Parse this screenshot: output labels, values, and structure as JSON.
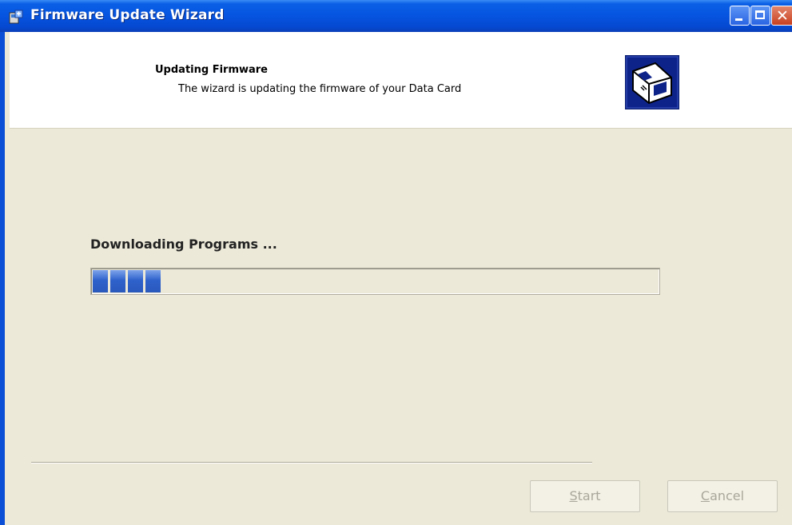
{
  "window": {
    "title": "Firmware Update Wizard",
    "controls": {
      "minimize": "minimize",
      "maximize": "maximize",
      "close": "✕"
    }
  },
  "header": {
    "title": "Updating Firmware",
    "subtitle": "The wizard is updating the firmware of your Data Card",
    "icon": "device-update-icon"
  },
  "status": {
    "label": "Downloading Programs ...",
    "progress_percent": 13
  },
  "buttons": {
    "start": {
      "mnemonic": "S",
      "rest": "tart",
      "enabled": false
    },
    "cancel": {
      "mnemonic": "C",
      "rest": "ancel",
      "enabled": false
    }
  },
  "colors": {
    "titlebar": "#0654e0",
    "progress": "#2f62cc",
    "background": "#ece9d8"
  }
}
